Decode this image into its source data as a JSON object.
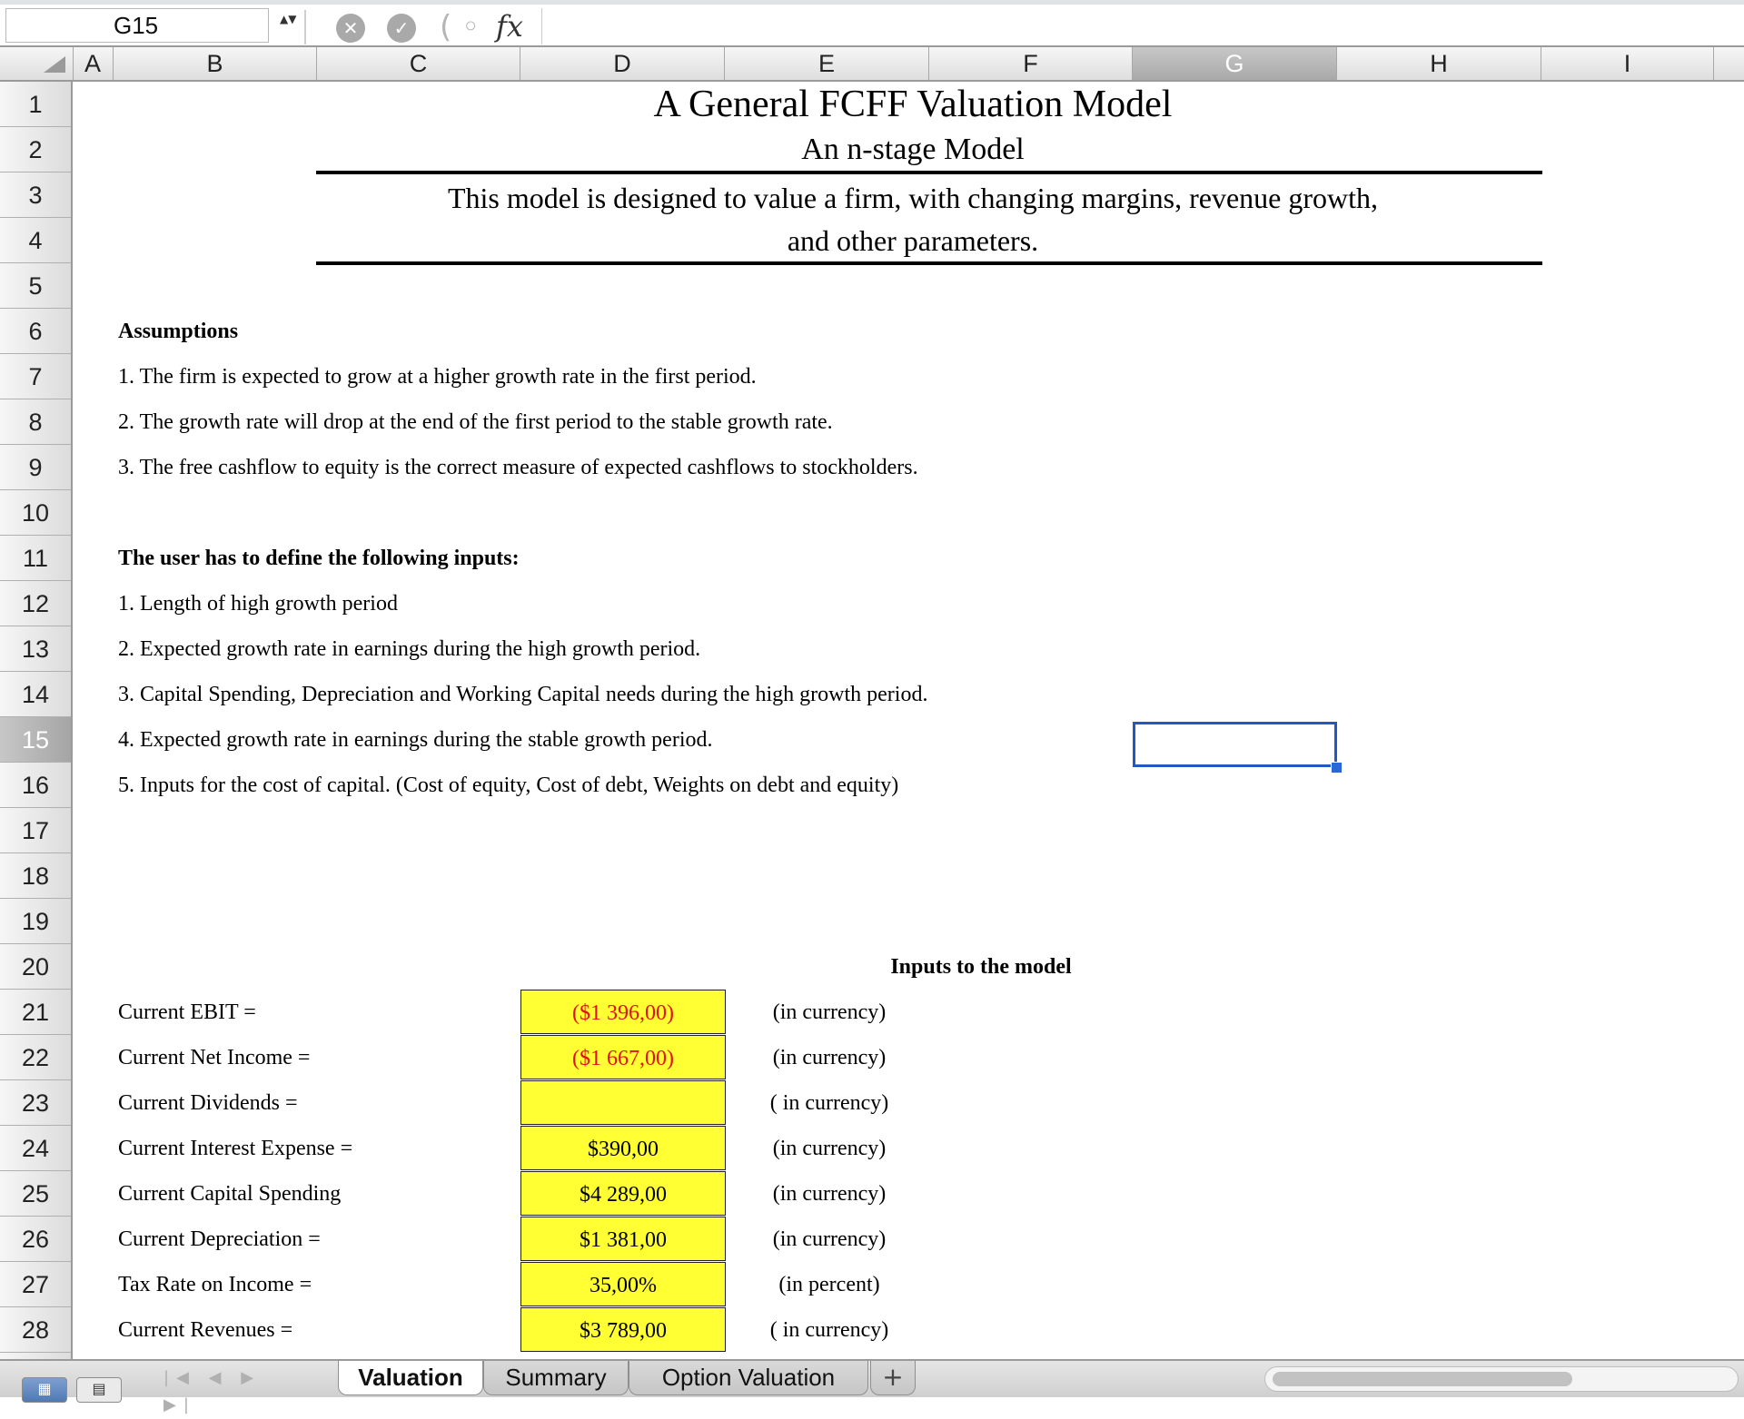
{
  "formula_bar": {
    "cell_ref": "G15",
    "stepper": "▲▼",
    "cancel_icon": "✕",
    "accept_icon": "✓",
    "fx_label": "fx",
    "formula": ""
  },
  "columns": [
    "A",
    "B",
    "C",
    "D",
    "E",
    "F",
    "G",
    "H",
    "I"
  ],
  "selected_column": "G",
  "rows": [
    "1",
    "2",
    "3",
    "4",
    "5",
    "6",
    "7",
    "8",
    "9",
    "10",
    "11",
    "12",
    "13",
    "14",
    "15",
    "16",
    "17",
    "18",
    "19",
    "20",
    "21",
    "22",
    "23",
    "24",
    "25",
    "26",
    "27",
    "28"
  ],
  "selected_row": "15",
  "sheet": {
    "title": "A General FCFF Valuation Model",
    "subtitle": "An n-stage Model",
    "description_line1": "This model is designed to value a firm, with changing margins, revenue growth,",
    "description_line2": "and other parameters.",
    "assumptions_heading": "Assumptions",
    "assumptions": [
      "1. The firm is expected to grow at a higher growth rate in the first period.",
      "2. The growth rate will drop at the end of the first period to the stable growth rate.",
      "3. The free cashflow to equity is the correct measure of expected cashflows to stockholders."
    ],
    "inputs_heading": "The user has to define the following inputs:",
    "inputs_list": [
      "1. Length of high growth period",
      "2. Expected growth rate in earnings during the high growth period.",
      "3. Capital Spending, Depreciation and Working Capital needs during the high growth period.",
      "4. Expected growth rate in earnings during the stable growth period.",
      "5. Inputs for the cost of capital. (Cost of equity, Cost of debt, Weights on debt and equity)"
    ],
    "model_inputs_heading": "Inputs to the model",
    "model_inputs": [
      {
        "label": "Current EBIT =",
        "value": "($1 396,00)",
        "unit": "(in currency)",
        "negative": true
      },
      {
        "label": "Current Net Income =",
        "value": "($1 667,00)",
        "unit": "(in currency)",
        "negative": true
      },
      {
        "label": "Current Dividends =",
        "value": "",
        "unit": "( in currency)",
        "negative": false
      },
      {
        "label": "Current Interest Expense =",
        "value": "$390,00",
        "unit": "(in currency)",
        "negative": false
      },
      {
        "label": "Current Capital Spending",
        "value": "$4 289,00",
        "unit": "(in currency)",
        "negative": false
      },
      {
        "label": "Current Depreciation =",
        "value": "$1 381,00",
        "unit": "(in currency)",
        "negative": false
      },
      {
        "label": "Tax Rate on Income =",
        "value": "35,00%",
        "unit": "(in percent)",
        "negative": false
      },
      {
        "label": "Current Revenues =",
        "value": "$3 789,00",
        "unit": "( in currency)",
        "negative": false
      }
    ]
  },
  "tabs": {
    "nav_arrows": "|◀ ◀ ▶ ▶|",
    "items": [
      "Valuation",
      "Summary",
      "Option Valuation"
    ],
    "active": "Valuation",
    "add_label": "+"
  },
  "view_buttons": {
    "normal": "▦",
    "page_layout": "▤"
  },
  "colors": {
    "input_fill": "#ffff33",
    "negative_text": "#e01010",
    "selection": "#2358c4"
  }
}
